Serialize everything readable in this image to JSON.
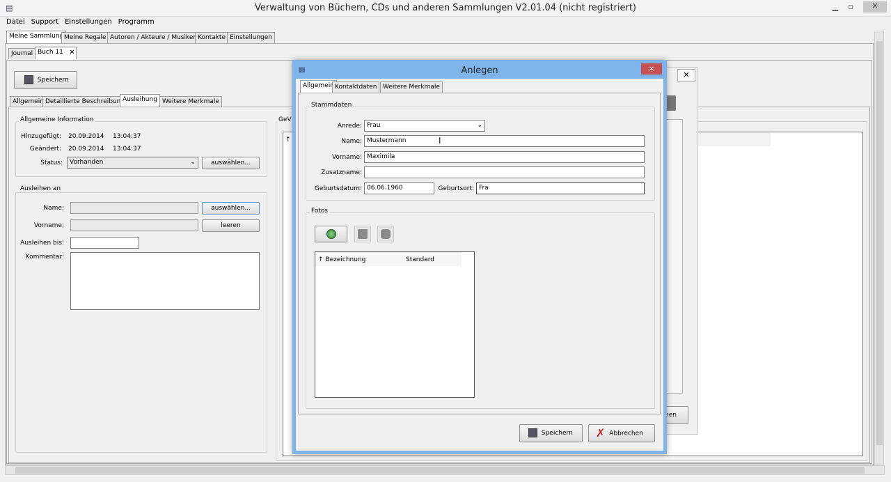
{
  "window": {
    "title": "Verwaltung von Büchern, CDs und anderen Sammlungen V2.01.04 (nicht registriert)"
  },
  "menu": [
    "Datei",
    "Support",
    "Einstellungen",
    "Programm"
  ],
  "main_tabs": [
    "Meine Sammlung",
    "Meine Regale",
    "Autoren / Akteure / Musiker",
    "Kontakte",
    "Einstellungen"
  ],
  "doc_tabs": {
    "journal": "Journal",
    "buch": "Buch 11",
    "close": "×"
  },
  "toolbar": {
    "save": "Speichern"
  },
  "sub_tabs": [
    "Allgemein",
    "Detaillierte Beschreibung",
    "Ausleihung",
    "Weitere Merkmale"
  ],
  "info": {
    "title": "Allgemeine Information",
    "added_label": "Hinzugefügt:",
    "added_date": "20.09.2014",
    "added_time": "13:04:37",
    "changed_label": "Geändert:",
    "changed_date": "20.09.2014",
    "changed_time": "13:04:37",
    "status_label": "Status:",
    "status_value": "Vorhanden",
    "select_button": "auswählen..."
  },
  "lend": {
    "title": "Ausleihen an",
    "name_label": "Name:",
    "vorname_label": "Vorname:",
    "until_label": "Ausleihen bis:",
    "comment_label": "Kommentar:",
    "select_button": "auswählen...",
    "clear_button": "leeren"
  },
  "behind": {
    "col_label": "GeV",
    "row_marker": "↑",
    "button_partial": "hen"
  },
  "dialog": {
    "title": "Anlegen",
    "close": "×",
    "tabs": [
      "Allgemein",
      "Kontaktdaten",
      "Weitere Merkmale"
    ],
    "stammdaten_title": "Stammdaten",
    "anrede_label": "Anrede:",
    "anrede_value": "Frau",
    "name_label": "Name:",
    "name_value": "Mustermann",
    "vorname_label": "Vorname:",
    "vorname_value": "Maximila",
    "zusatz_label": "Zusatzname:",
    "zusatz_value": "",
    "geburtsdatum_label": "Geburtsdatum:",
    "geburtsdatum_value": "06.06.1960",
    "geburtsort_label": "Geburtsort:",
    "geburtsort_value": "Fra",
    "fotos_title": "Fotos",
    "table": {
      "col1": "↑ Bezeichnung",
      "col2": "Standard"
    },
    "save": "Speichern",
    "cancel": "Abbrechen"
  }
}
